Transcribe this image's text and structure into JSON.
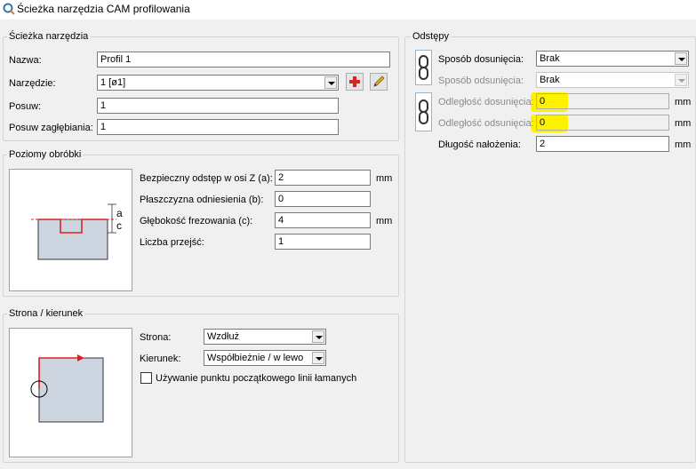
{
  "window": {
    "title": "Ścieżka narzędzia CAM profilowania",
    "icon": "app-q-icon"
  },
  "toolpath": {
    "group_label": "Ścieżka narzędzia",
    "name_label": "Nazwa:",
    "name_value": "Profil 1",
    "tool_label": "Narzędzie:",
    "tool_value": "1 [ø1]",
    "feed_label": "Posuw:",
    "feed_value": "1",
    "plunge_label": "Posuw zagłębiania:",
    "plunge_value": "1",
    "add_tool_icon": "plus-icon",
    "edit_tool_icon": "pencil-icon"
  },
  "levels": {
    "group_label": "Poziomy obróbki",
    "safe_label": "Bezpieczny odstęp w osi Z (a):",
    "safe_value": "2",
    "safe_unit": "mm",
    "ref_label": "Płaszczyzna odniesienia (b):",
    "ref_value": "0",
    "depth_label": "Głębokość frezowania (c):",
    "depth_value": "4",
    "depth_unit": "mm",
    "passes_label": "Liczba przejść:",
    "passes_value": "1",
    "diagram_a": "a",
    "diagram_c": "c"
  },
  "side": {
    "group_label": "Strona / kierunek",
    "side_label": "Strona:",
    "side_value": "Wzdłuż",
    "direction_label": "Kierunek:",
    "direction_value": "Współbieżnie / w lewo",
    "checkbox_label": "Używanie punktu początkowego linii łamanych",
    "checkbox_checked": false
  },
  "offsets": {
    "group_label": "Odstępy",
    "approach_label": "Sposób dosunięcia:",
    "approach_value": "Brak",
    "retract_label": "Sposób odsunięcia:",
    "retract_value": "Brak",
    "approach_dist_label": "Odległość dosunięcia:",
    "approach_dist_value": "0",
    "approach_dist_unit": "mm",
    "retract_dist_label": "Odległość odsunięcia:",
    "retract_dist_value": "0",
    "retract_dist_unit": "mm",
    "overlap_label": "Długość nałożenia:",
    "overlap_value": "2",
    "overlap_unit": "mm",
    "highlight_color": "#fff200",
    "link_icon": "chain-link-icon"
  }
}
